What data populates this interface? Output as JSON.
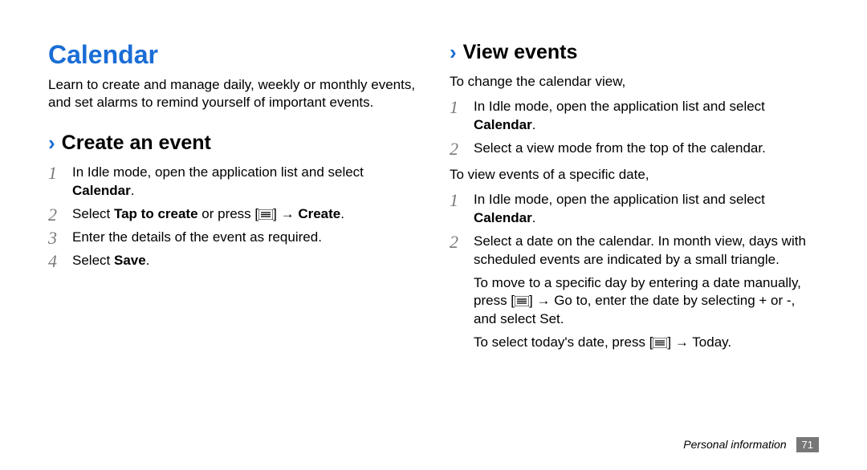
{
  "title": "Calendar",
  "intro": "Learn to create and manage daily, weekly or monthly events, and set alarms to remind yourself of important events.",
  "create": {
    "heading": "Create an event",
    "steps": [
      {
        "pre": "In Idle mode, open the application list and select ",
        "bold": "Calendar",
        "post": "."
      },
      {
        "pre": "Select ",
        "bold": "Tap to create",
        "mid": " or press [",
        "icon": true,
        "mid2": "] → ",
        "bold2": "Create",
        "post": "."
      },
      {
        "pre": "Enter the details of the event as required."
      },
      {
        "pre": "Select ",
        "bold": "Save",
        "post": "."
      }
    ]
  },
  "view": {
    "heading": "View events",
    "lead1": "To change the calendar view,",
    "steps1": [
      {
        "pre": "In Idle mode, open the application list and select ",
        "bold": "Calendar",
        "post": "."
      },
      {
        "pre": "Select a view mode from the top of the calendar."
      }
    ],
    "lead2": "To view events of a specific date,",
    "steps2": [
      {
        "pre": "In Idle mode, open the application list and select ",
        "bold": "Calendar",
        "post": "."
      },
      {
        "pre": "Select a date on the calendar. In month view, days with scheduled events are indicated by a small triangle."
      }
    ],
    "extra1": {
      "pre": "To move to a specific day by entering a date manually, press [",
      "icon": true,
      "mid": "] → ",
      "bold": "Go to",
      "mid2": ", enter the date by selecting ",
      "bold2": "+",
      "mid3": " or ",
      "bold3": "-",
      "mid4": ", and select ",
      "bold4": "Set",
      "post": "."
    },
    "extra2": {
      "pre": "To select today's date, press [",
      "icon": true,
      "mid": "] → ",
      "bold": "Today",
      "post": "."
    }
  },
  "footer": {
    "section": "Personal information",
    "page": "71"
  }
}
